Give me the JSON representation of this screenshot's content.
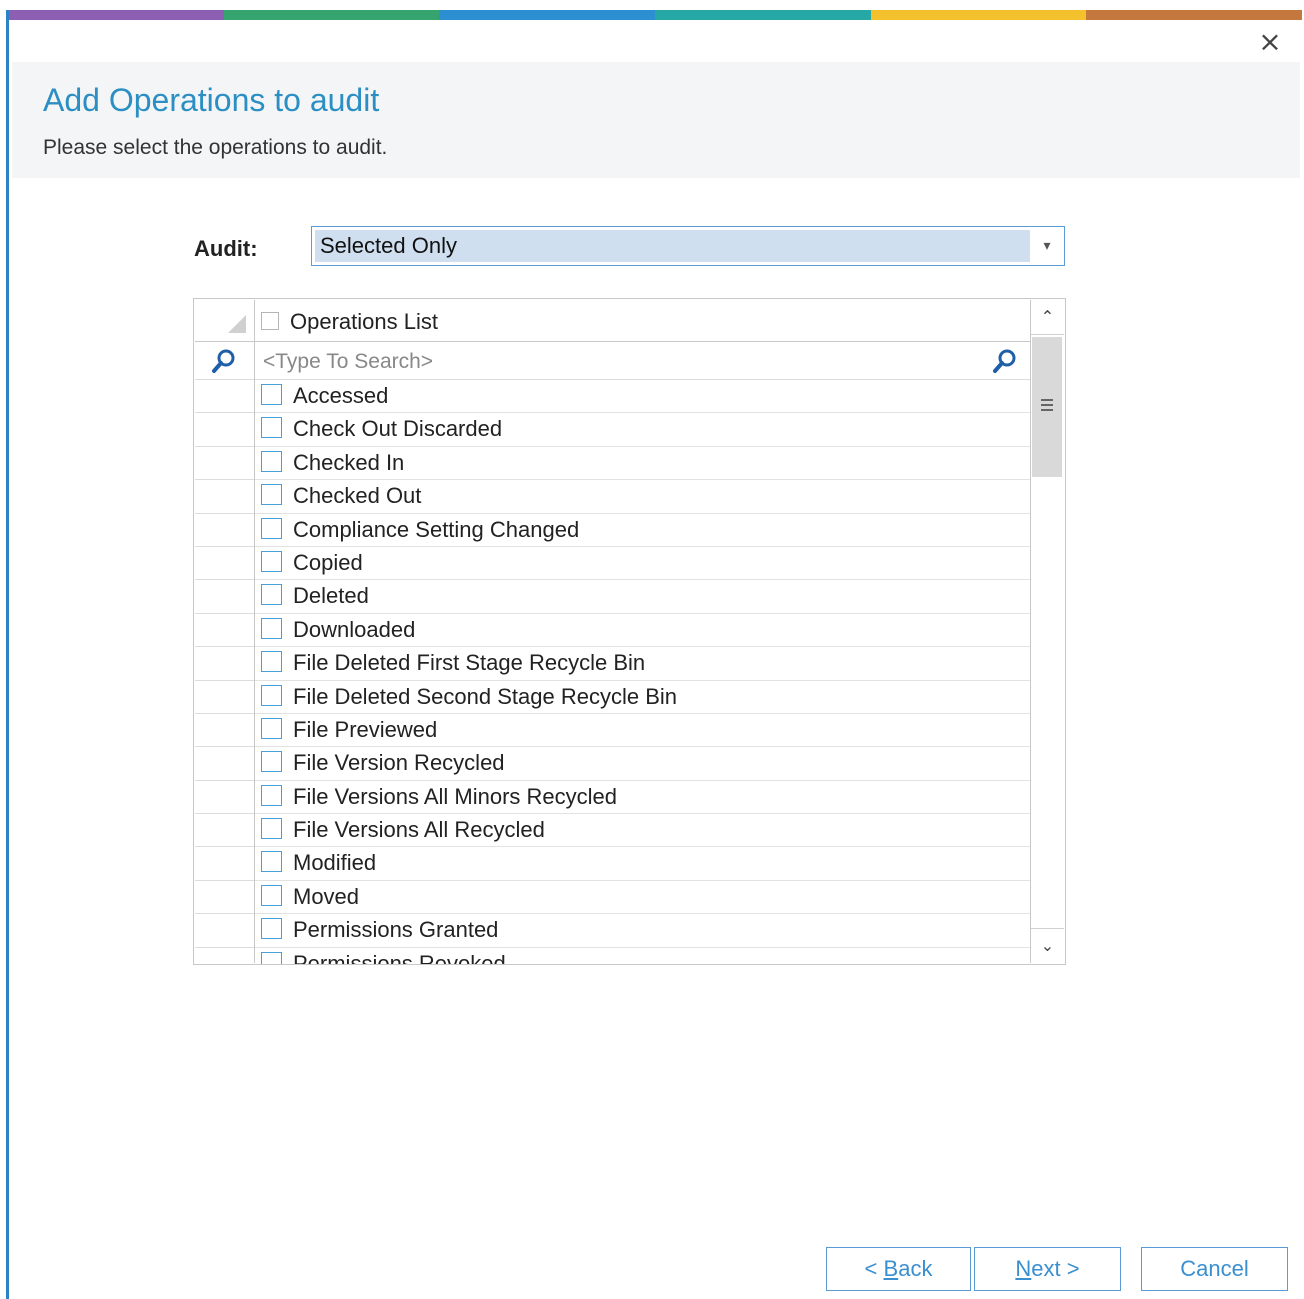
{
  "colors": {
    "accent_bar": [
      "#8d5fb2",
      "#35a46f",
      "#2b8fd1",
      "#25a8a6",
      "#f3c12c",
      "#c4783e"
    ],
    "title": "#2b8fc4",
    "selection": "#cfdff0"
  },
  "dialog": {
    "close_icon": "×",
    "title": "Add Operations to audit",
    "subtitle": "Please select the operations to audit."
  },
  "audit": {
    "label": "Audit:",
    "selected_value": "Selected Only",
    "dropdown_icon": "▾"
  },
  "grid": {
    "header_label": "Operations List",
    "search_placeholder": "<Type To Search>",
    "operations": [
      "Accessed",
      "Check Out Discarded",
      "Checked In",
      "Checked Out",
      "Compliance Setting Changed",
      "Copied",
      "Deleted",
      "Downloaded",
      "File Deleted First Stage Recycle Bin",
      "File Deleted Second Stage Recycle Bin",
      "File Previewed",
      "File Version Recycled",
      "File Versions All Minors Recycled",
      "File Versions All Recycled",
      "Modified",
      "Moved",
      "Permissions Granted",
      "Permissions Revoked"
    ],
    "scroll_up_icon": "⌃",
    "scroll_down_icon": "⌄"
  },
  "buttons": {
    "back_prefix": "< ",
    "back_mnemonic": "B",
    "back_rest": "ack",
    "next_mnemonic": "N",
    "next_rest": "ext >",
    "cancel": "Cancel"
  }
}
